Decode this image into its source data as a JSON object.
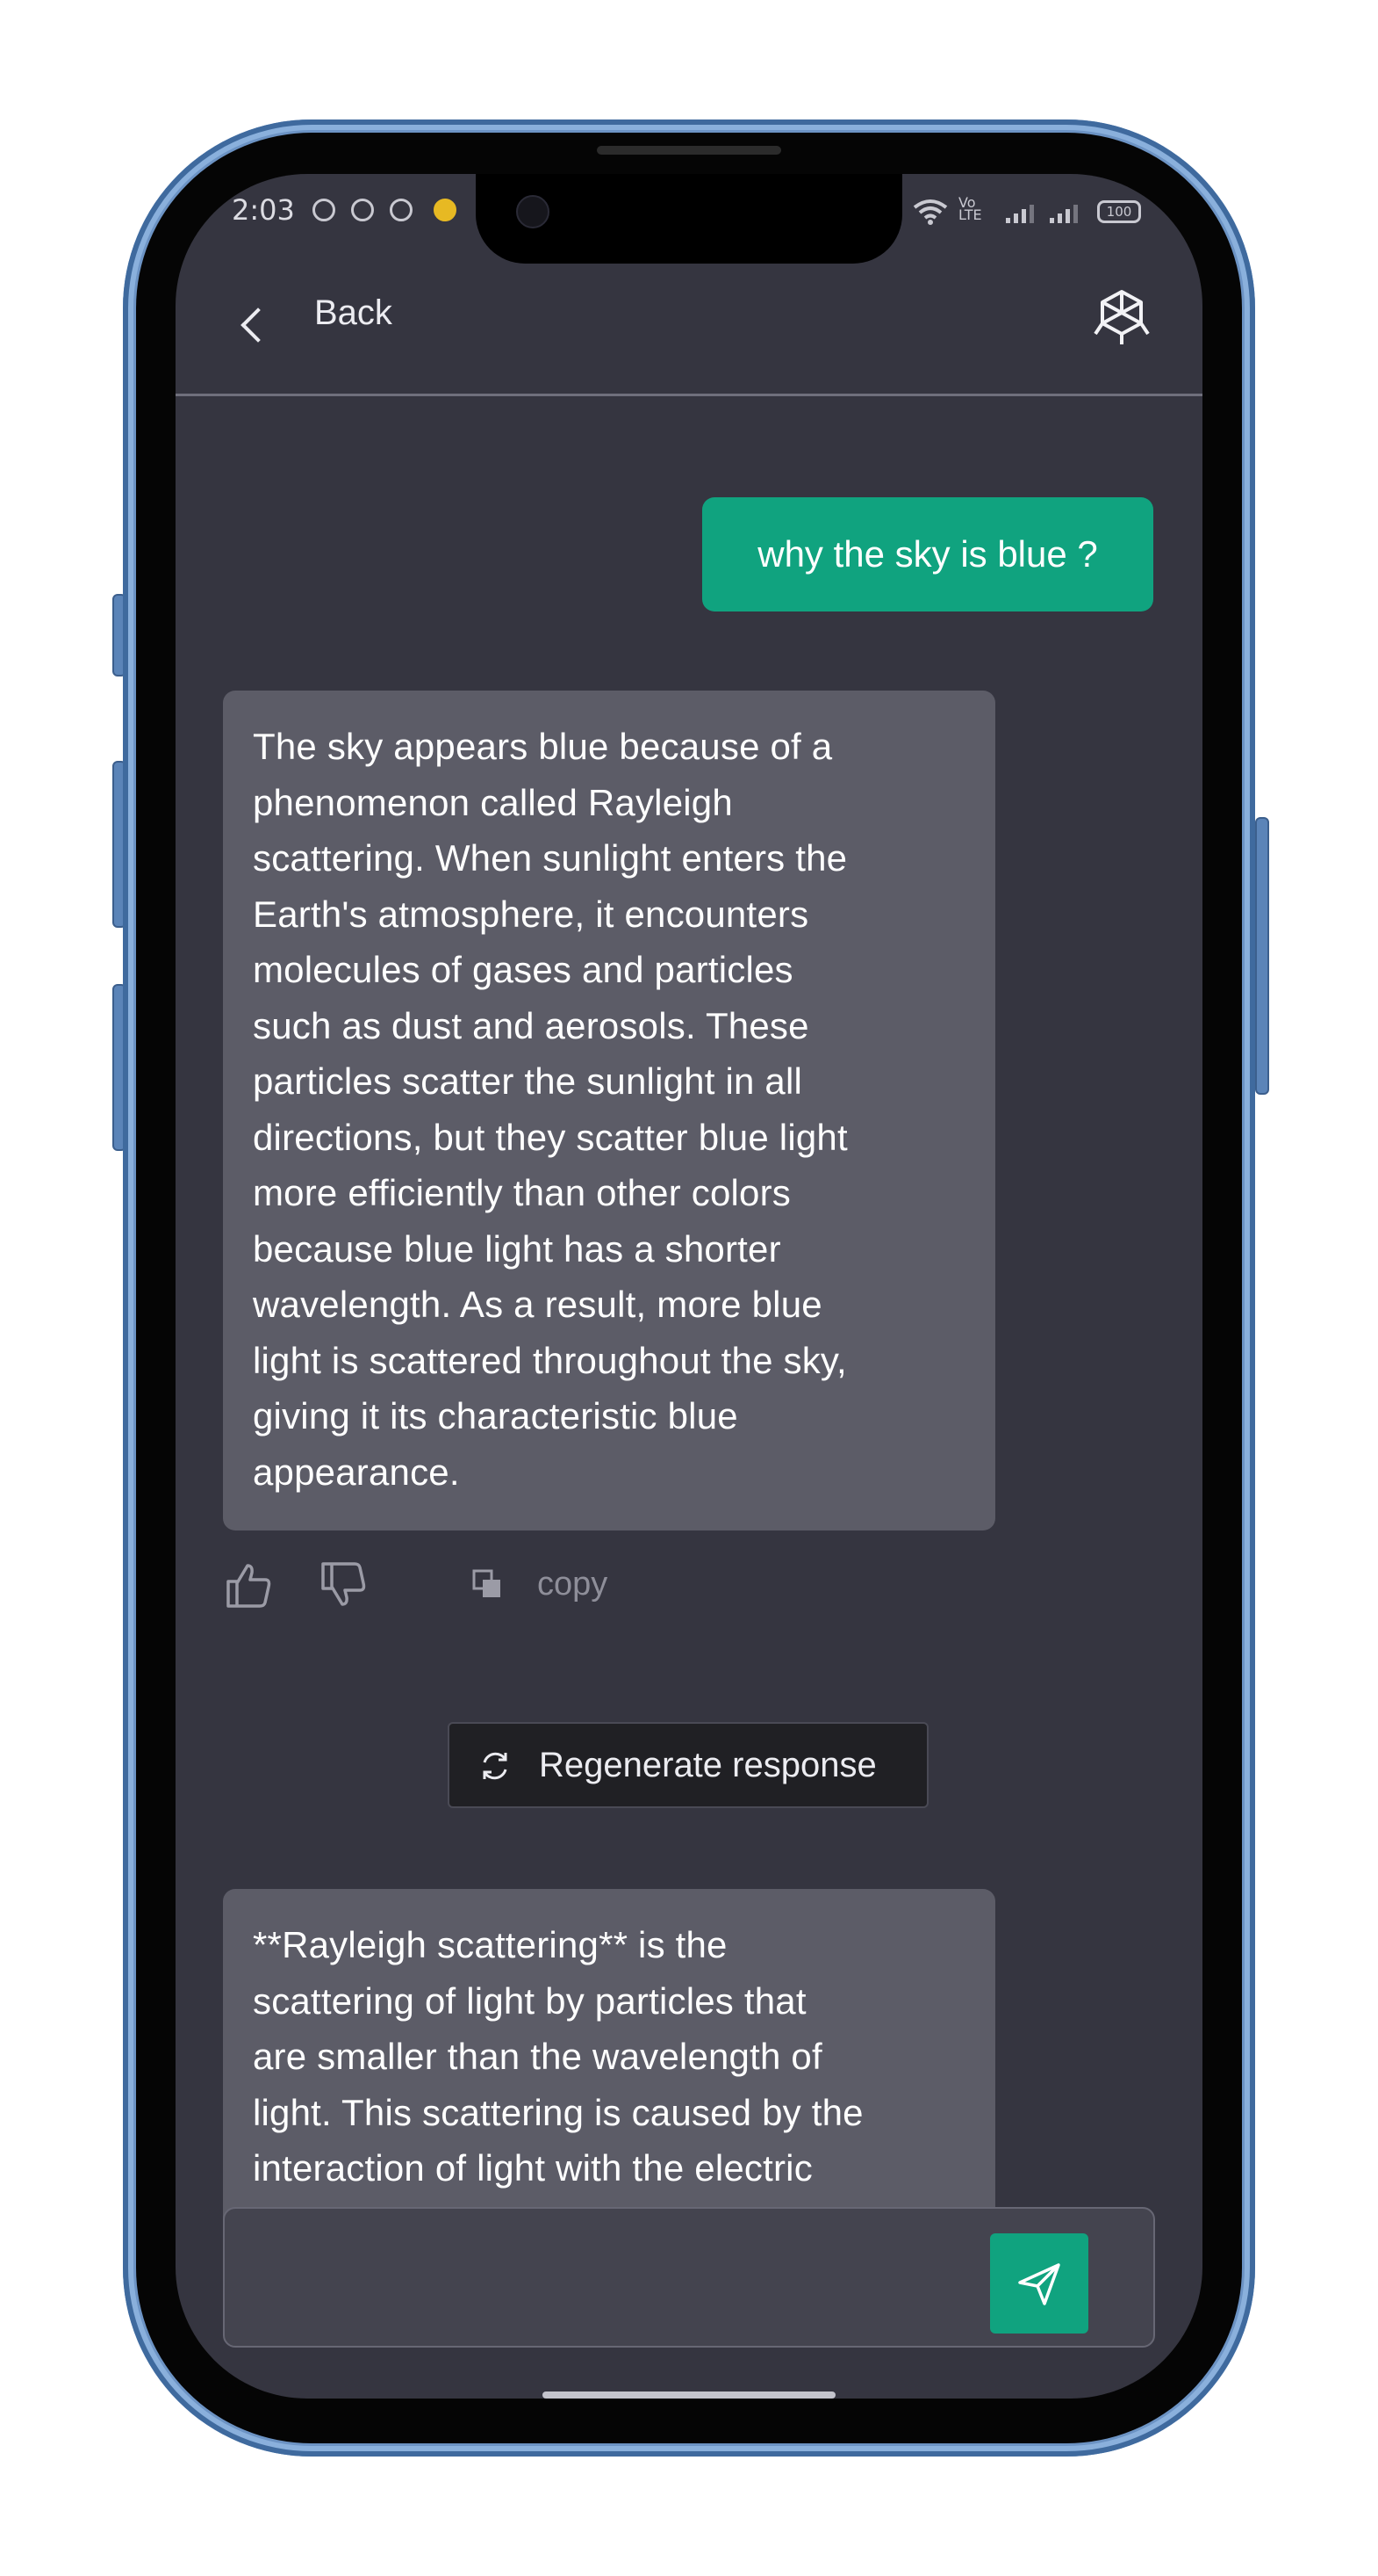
{
  "status_bar": {
    "time": "2:03",
    "battery": "100"
  },
  "header": {
    "back_label": "Back",
    "logo_icon": "openai-logo-icon"
  },
  "conversation": {
    "user_message": "why the sky is blue ?",
    "assistant_message_1": "The sky appears blue because of a\nphenomenon called Rayleigh\nscattering. When sunlight enters the\nEarth's atmosphere, it encounters\nmolecules of gases and particles\nsuch as dust and aerosols. These\nparticles scatter the sunlight in all\ndirections, but they scatter blue light\nmore efficiently than other colors\nbecause blue light has a shorter\nwavelength. As a result, more blue\nlight is scattered throughout the sky,\ngiving it its characteristic blue\nappearance.",
    "assistant_message_2": "**Rayleigh scattering** is the\nscattering of light by particles that\nare smaller than the wavelength of\nlight. This scattering is caused by the\ninteraction of light with the electric\nfields of the particles. The amount of"
  },
  "actions": {
    "thumbs_up_icon": "thumbs-up-icon",
    "thumbs_down_icon": "thumbs-down-icon",
    "copy_icon": "copy-icon",
    "copy_label": "copy"
  },
  "regenerate": {
    "label": "Regenerate response",
    "icon": "refresh-icon"
  },
  "composer": {
    "input_value": "",
    "send_icon": "send-icon"
  },
  "colors": {
    "background": "#353540",
    "user_bubble": "#10a37f",
    "assistant_bubble": "#5c5c67",
    "accent": "#10a37f"
  }
}
